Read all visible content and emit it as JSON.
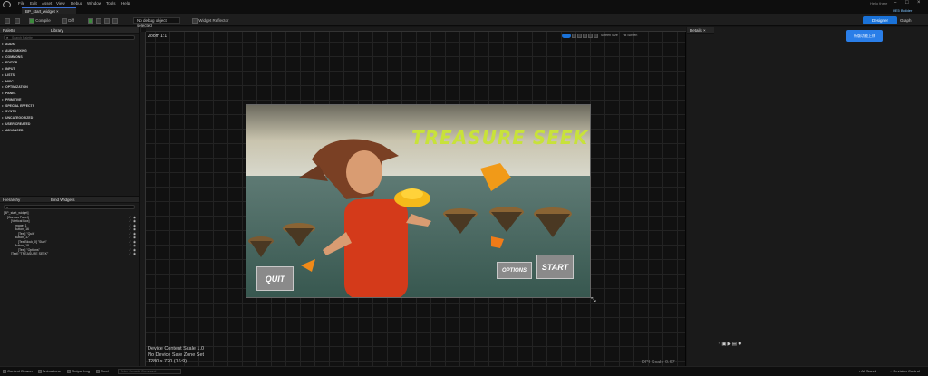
{
  "menubar": {
    "items": [
      "File",
      "Edit",
      "Asset",
      "View",
      "Debug",
      "Window",
      "Tools",
      "Help"
    ],
    "project": "Hello there",
    "user": "UE5 Builder"
  },
  "tab": {
    "label": "BP_start_widget"
  },
  "toolbar": {
    "compile": "Compile",
    "diff": "Diff",
    "debug_object": "No debug object selected",
    "reflector": "Widget Reflector",
    "designer": "Designer",
    "graph": "Graph"
  },
  "palette": {
    "title": "Palette",
    "library": "Library",
    "search_placeholder": "Search Palette",
    "categories": [
      "AUDIO",
      "AUDIOMIXING",
      "COMMONS",
      "EDITOR",
      "INPUT",
      "LISTS",
      "MISC",
      "OPTIMIZATION",
      "PANEL",
      "PRIMITIVE",
      "SPECIAL EFFECTS",
      "SYNTH",
      "UNCATEGORIZED",
      "USER CREATED",
      "ADVANCED"
    ]
  },
  "hierarchy": {
    "title": "Hierarchy",
    "bind": "Bind Widgets",
    "nodes": [
      "[BP_start_widget]",
      "[Canvas Panel]",
      "[Vertical Box]",
      "Image_1",
      "Button_16",
      "[Text] \"Quit\"",
      "Button_17",
      "[TextBlock_0] \"Start\"",
      "Button_18",
      "[Text] \"Options\"",
      "[Text] \"TREASURE SEEK\""
    ]
  },
  "canvas": {
    "zoom": "Zoom 1:1",
    "screen_size": "Screen Size",
    "fill_screen": "Fill Screen",
    "info_lines": [
      "Device Content Scale 1.0",
      "No Device Safe Zone Set",
      "1280 x 720 (16:9)"
    ],
    "dpi": "DPI Scale 0.67"
  },
  "game": {
    "title": "TREASURE SEEK",
    "quit": "QUIT",
    "options": "OPTIONS",
    "start": "START"
  },
  "details": {
    "title": "Details",
    "badge": "新版功能上线"
  },
  "status": {
    "drawer": "Content Drawer",
    "anim": "Animations",
    "log": "Output Log",
    "cmd": "Cmd",
    "cmd_placeholder": "Enter Console Command",
    "saved": "All Saved",
    "revision": "Revision Control"
  },
  "colors": {
    "accent": "#1a72d8",
    "title_yellow": "#c8e23a"
  }
}
